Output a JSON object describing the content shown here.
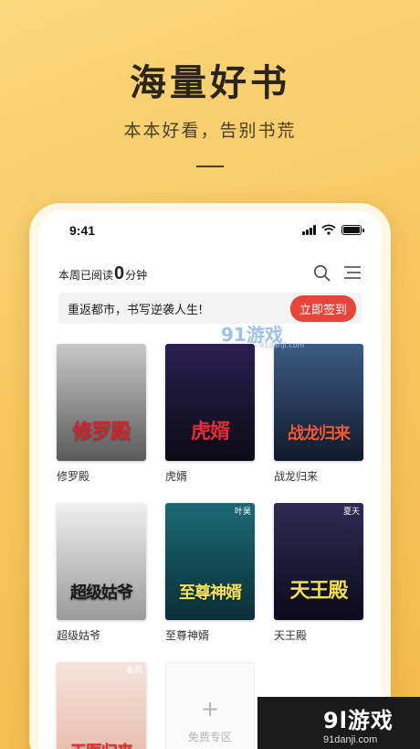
{
  "promo": {
    "headline": "海量好书",
    "subline": "本本好看，告别书荒"
  },
  "status_bar": {
    "time": "9:41"
  },
  "reading": {
    "prefix": "本周已阅读",
    "count": "0",
    "unit": "分钟"
  },
  "banner": {
    "text": "重返都市，书写逆袭人生!",
    "checkin_label": "立即签到"
  },
  "books": [
    {
      "title": "修罗殿",
      "cover_text": "修罗殿",
      "cover_colors": [
        "#c9c9c9",
        "#5a5a5a"
      ],
      "text_color": "#d8222a",
      "tag": ""
    },
    {
      "title": "虎婿",
      "cover_text": "虎婿",
      "cover_colors": [
        "#2a2050",
        "#0b0b14"
      ],
      "text_color": "#e52a3a",
      "tag": ""
    },
    {
      "title": "战龙归来",
      "cover_text": "战龙归来",
      "cover_colors": [
        "#3d5b82",
        "#101a2c"
      ],
      "text_color": "#f15a3a",
      "tag": ""
    },
    {
      "title": "超级姑爷",
      "cover_text": "超级姑爷",
      "cover_colors": [
        "#f0f0f0",
        "#9a9a9a"
      ],
      "text_color": "#1a1a1a",
      "tag": ""
    },
    {
      "title": "至尊神婿",
      "cover_text": "至尊神婿",
      "cover_colors": [
        "#1b6b74",
        "#0b2e38"
      ],
      "text_color": "#f3e25a",
      "tag": "叶昊"
    },
    {
      "title": "天王殿",
      "cover_text": "天王殿",
      "cover_colors": [
        "#2f2b52",
        "#0c0a1d"
      ],
      "text_color": "#f2e04a",
      "tag": "夏天"
    },
    {
      "title": "",
      "cover_text": "天医归来",
      "cover_colors": [
        "#f6e3da",
        "#e4b5a4"
      ],
      "text_color": "#e8302a",
      "tag": "秦风"
    }
  ],
  "free_zone": {
    "label": "免费专区"
  },
  "watermark": {
    "center_text": "91游戏",
    "center_sub": "91danji.com",
    "corner_main": "9l游戏",
    "corner_sub": "91danji.com"
  }
}
